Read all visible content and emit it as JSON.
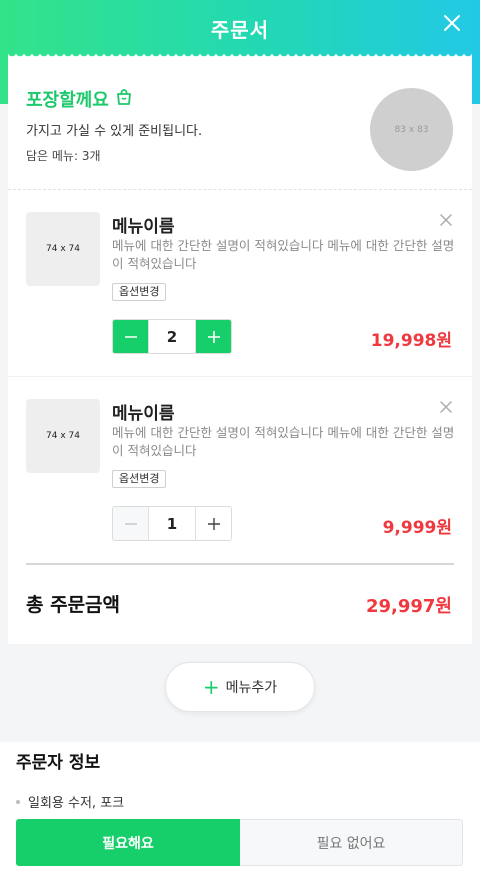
{
  "header": {
    "title": "주문서",
    "close_icon": "close-icon"
  },
  "packaging": {
    "title": "포장할께요",
    "description": "가지고 가실 수 있게 준비됩니다.",
    "menu_count": "담은 메뉴: 3개",
    "image_placeholder": "83 x 83"
  },
  "items": [
    {
      "name": "메뉴이름",
      "description": "메뉴에 대한 간단한 설명이 적혀있습니다 메뉴에 대한 간단한 설명이 적혀있습니다",
      "thumb_placeholder": "74 x 74",
      "option_label": "옵션변경",
      "quantity": "2",
      "price": "19,998원",
      "minus_enabled": true
    },
    {
      "name": "메뉴이름",
      "description": "메뉴에 대한 간단한 설명이 적혀있습니다 메뉴에 대한 간단한 설명이 적혀있습니다",
      "thumb_placeholder": "74 x 74",
      "option_label": "옵션변경",
      "quantity": "1",
      "price": "9,999원",
      "minus_enabled": false
    }
  ],
  "total": {
    "label": "총 주문금액",
    "value": "29,997원"
  },
  "add_menu": {
    "label": "메뉴추가"
  },
  "orderer": {
    "title": "주문자 정보",
    "cutlery_label": "일회용 수저, 포크",
    "yes_label": "필요해요",
    "no_label": "필요 없어요"
  },
  "colors": {
    "accent_green": "#17cf6a",
    "price_red": "#f0383f",
    "gradient_start": "#33e389",
    "gradient_end": "#22c9e6"
  }
}
